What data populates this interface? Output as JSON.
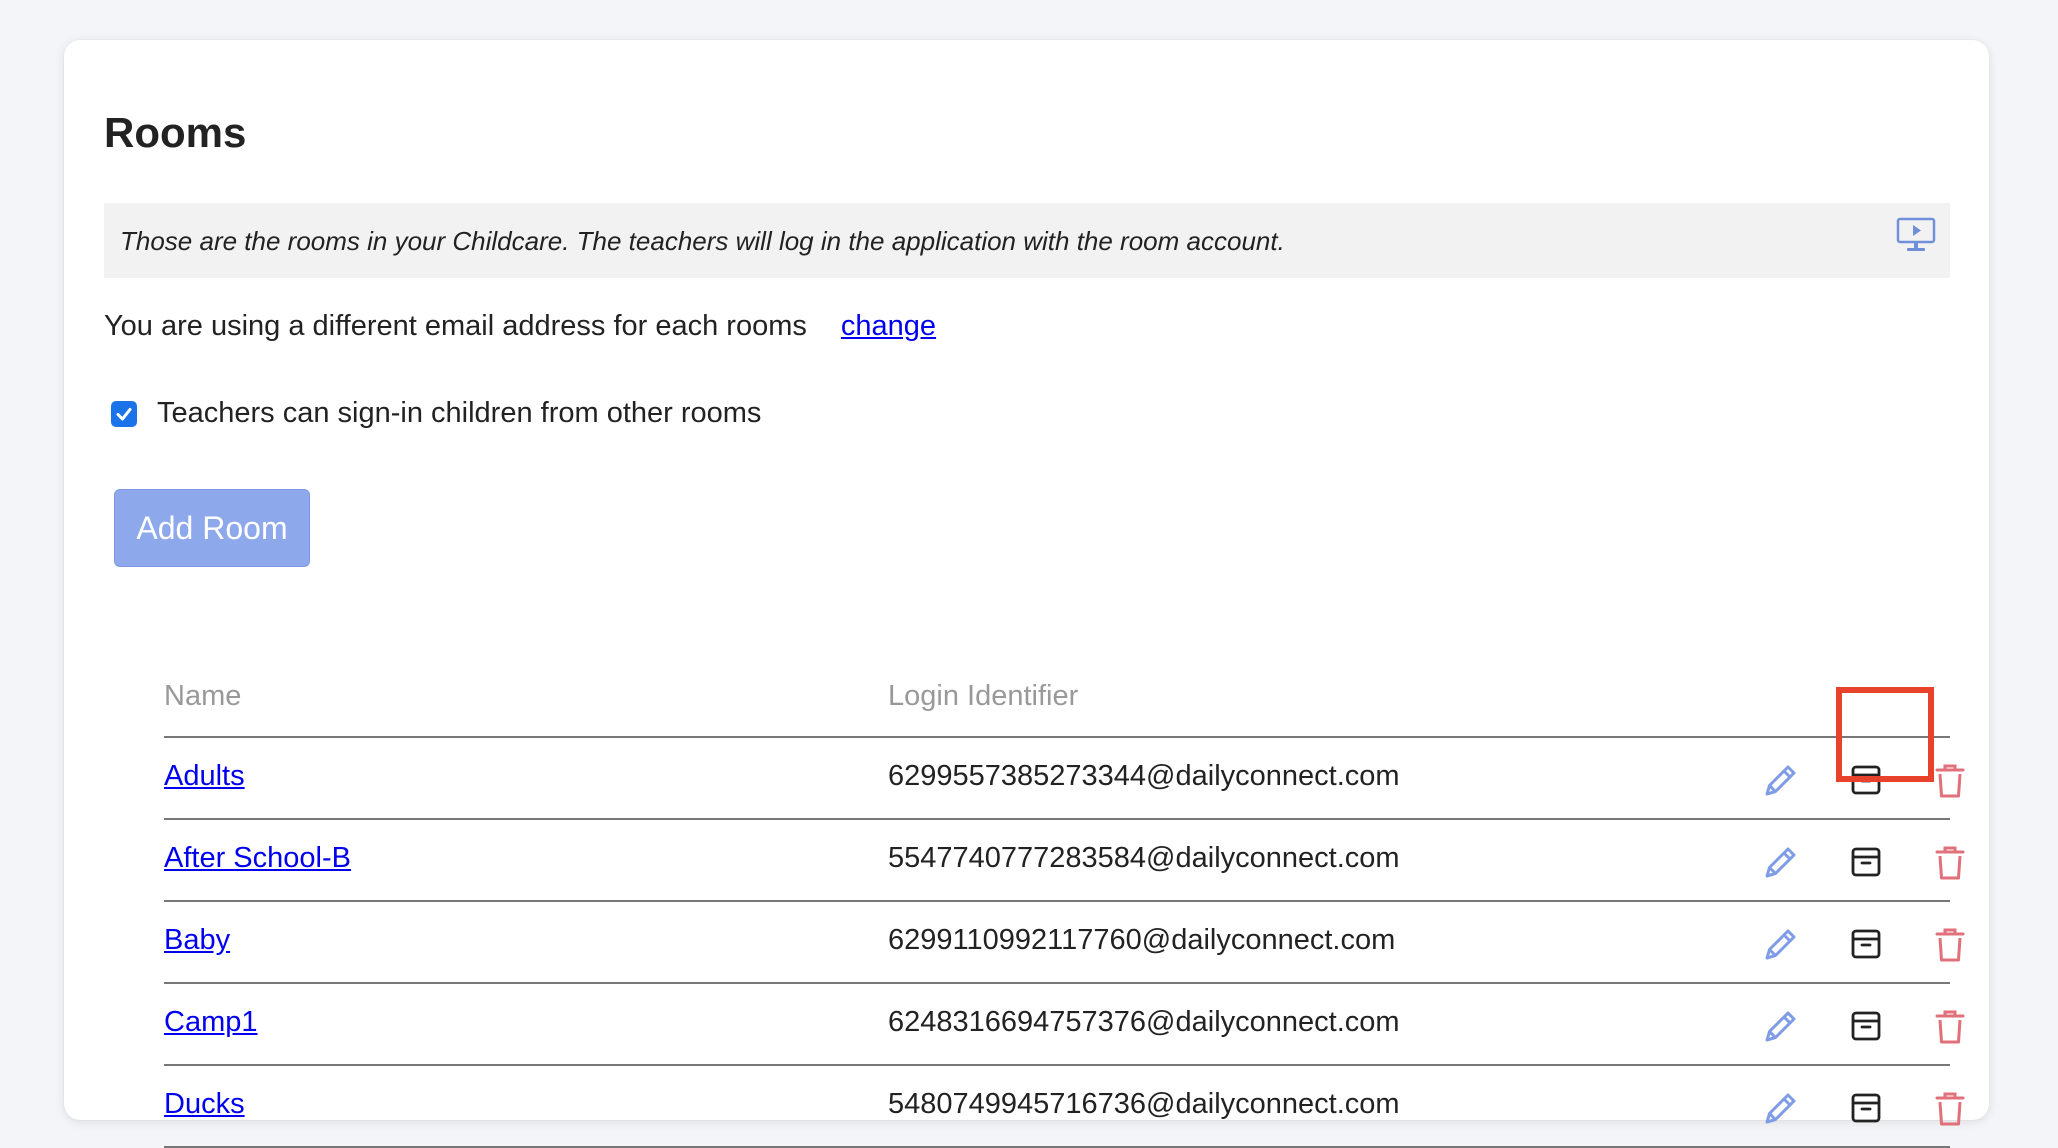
{
  "page": {
    "title": "Rooms",
    "info_text": "Those are the rooms in your Childcare. The teachers will log in the application with the room account.",
    "info_icon": "video-tutorial-icon",
    "email_mode_text": "You are using a different email address for each rooms",
    "change_link": "change",
    "checkbox_label": "Teachers can sign-in children from other rooms",
    "checkbox_checked": true,
    "add_button": "Add Room"
  },
  "table": {
    "headers": {
      "name": "Name",
      "login": "Login Identifier"
    },
    "rows": [
      {
        "name": "Adults",
        "login": "6299557385273344@dailyconnect.com"
      },
      {
        "name": "After School-B",
        "login": "5547740777283584@dailyconnect.com"
      },
      {
        "name": "Baby",
        "login": "6299110992117760@dailyconnect.com"
      },
      {
        "name": "Camp1",
        "login": "6248316694757376@dailyconnect.com"
      },
      {
        "name": "Ducks",
        "login": "5480749945716736@dailyconnect.com"
      }
    ],
    "row_actions": [
      "edit-icon",
      "archive-icon",
      "trash-icon"
    ]
  },
  "colors": {
    "link": "#0000ee",
    "button": "#8ea8ec",
    "edit_icon": "#7f9ce6",
    "delete_icon": "#e0707a",
    "highlight": "#e8412c",
    "checkbox": "#1a73e8"
  }
}
